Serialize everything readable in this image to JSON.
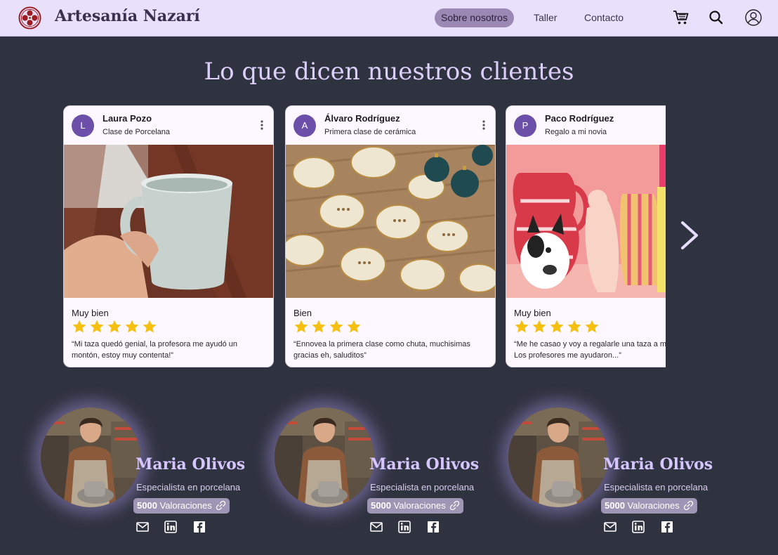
{
  "header": {
    "brand": "Artesanía Nazarí",
    "nav": [
      {
        "label": "Sobre nosotros",
        "active": true
      },
      {
        "label": "Taller",
        "active": false
      },
      {
        "label": "Contacto",
        "active": false
      }
    ],
    "icons": [
      "cart-icon",
      "search-icon",
      "user-icon"
    ]
  },
  "testimonials": {
    "heading": "Lo que dicen nuestros clientes",
    "cards": [
      {
        "initial": "L",
        "name": "Laura Pozo",
        "subtitle": "Clase de Porcelana",
        "rating_label": "Muy bien",
        "stars": 5,
        "quote": "“Mi taza quedó genial, la profesora me ayudó un montón, estoy muy contenta!”"
      },
      {
        "initial": "A",
        "name": "Álvaro Rodríguez",
        "subtitle": "Primera clase de cerámica",
        "rating_label": "Bien",
        "stars": 4,
        "quote": "“Ennovea la primera clase como chuta, muchisimas gracias eh, saluditos”"
      },
      {
        "initial": "P",
        "name": "Paco Rodríguez",
        "subtitle": "Regalo a mi novia",
        "rating_label": "Muy bien",
        "stars": 5,
        "quote": "“Me he casao y voy a regalarle una taza a mi novia. Los profesores me ayudaron...”"
      }
    ]
  },
  "team": [
    {
      "name": "Maria Olivos",
      "role": "Especialista en porcelana",
      "ratings_count": "5000",
      "ratings_label": "Valoraciones"
    },
    {
      "name": "Maria Olivos",
      "role": "Especialista en porcelana",
      "ratings_count": "5000",
      "ratings_label": "Valoraciones"
    },
    {
      "name": "Maria Olivos",
      "role": "Especialista en porcelana",
      "ratings_count": "5000",
      "ratings_label": "Valoraciones"
    }
  ],
  "colors": {
    "background": "#2f323f",
    "header_bg": "#e9e1fc",
    "accent": "#9c88b5",
    "star": "#f6c012",
    "heading": "#dcd0fb"
  }
}
